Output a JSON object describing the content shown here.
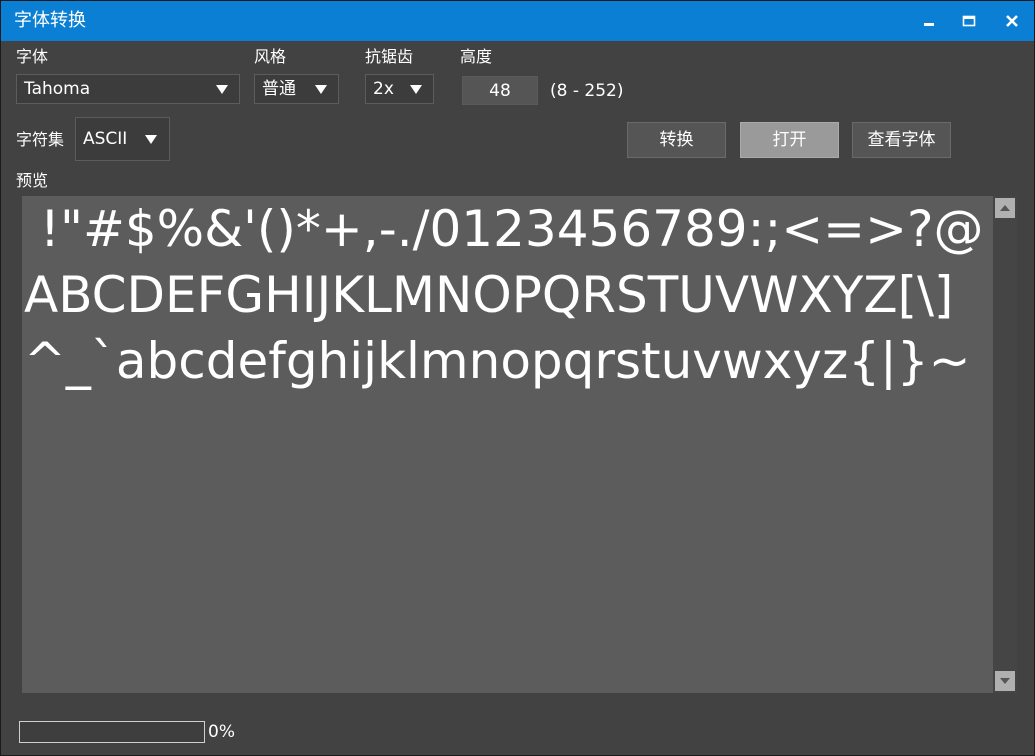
{
  "window": {
    "title": "字体转换",
    "controls": {
      "minimize_icon": "minimize-icon",
      "maximize_icon": "maximize-icon",
      "close_icon": "close-icon"
    }
  },
  "labels": {
    "font": "字体",
    "style": "风格",
    "antialias": "抗锯齿",
    "height": "高度",
    "charset": "字符集",
    "preview": "预览"
  },
  "font_select": {
    "value": "Tahoma"
  },
  "style_select": {
    "value": "普通"
  },
  "antialias_select": {
    "value": "2x"
  },
  "height_input": {
    "value": "48",
    "range": "(8 - 252)"
  },
  "charset_select": {
    "value": "ASCII"
  },
  "buttons": {
    "convert": "转换",
    "open": "打开",
    "view_font": "查看字体"
  },
  "preview": {
    "text": " !\"#$%&'()*+,-./0123456789:;<=>?@ABCDEFGHIJKLMNOPQRSTUVWXYZ[\\]^_`abcdefghijklmnopqrstuvwxyz{|}~"
  },
  "progress": {
    "percent": 0,
    "label": "0%"
  },
  "colors": {
    "titlebar": "#0a7fd3",
    "window_bg": "#424242",
    "preview_bg": "#5c5c5c",
    "button_bg": "#555555",
    "button_active_bg": "#9a9a9a"
  }
}
